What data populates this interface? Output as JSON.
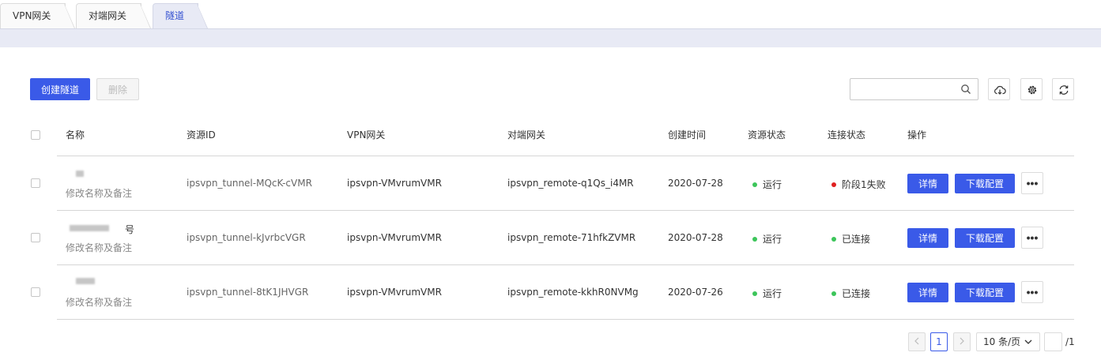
{
  "tabs": [
    {
      "label": "VPN网关"
    },
    {
      "label": "对端网关"
    },
    {
      "label": "隧道"
    }
  ],
  "toolbar": {
    "create_label": "创建隧道",
    "delete_label": "删除",
    "search_value": "",
    "icons": [
      "search-icon",
      "cloud-download-icon",
      "gear-icon",
      "refresh-icon"
    ]
  },
  "table": {
    "columns": [
      "名称",
      "资源ID",
      "VPN网关",
      "对端网关",
      "创建时间",
      "资源状态",
      "连接状态",
      "操作"
    ],
    "rows": [
      {
        "name_visible": "",
        "name_suffix": "",
        "edit_link": "修改名称及备注",
        "resource_id": "ipsvpn_tunnel-MQcK-cVMR",
        "vpn_gateway": "ipsvpn-VMvrumVMR",
        "remote_gateway": "ipsvpn_remote-q1Qs_i4MR",
        "created": "2020-07-28",
        "resource_status": "运行",
        "connection_status": "阶段1失败",
        "connection_color": "#e02020",
        "detail_label": "详情",
        "download_label": "下载配置",
        "more_label": "•••"
      },
      {
        "name_visible": "",
        "name_suffix": "号",
        "edit_link": "修改名称及备注",
        "resource_id": "ipsvpn_tunnel-kJvrbcVGR",
        "vpn_gateway": "ipsvpn-VMvrumVMR",
        "remote_gateway": "ipsvpn_remote-71hfkZVMR",
        "created": "2020-07-28",
        "resource_status": "运行",
        "connection_status": "已连接",
        "connection_color": "#3cc55a",
        "detail_label": "详情",
        "download_label": "下载配置",
        "more_label": "•••"
      },
      {
        "name_visible": "",
        "name_suffix": "",
        "edit_link": "修改名称及备注",
        "resource_id": "ipsvpn_tunnel-8tK1JHVGR",
        "vpn_gateway": "ipsvpn-VMvrumVMR",
        "remote_gateway": "ipsvpn_remote-kkhR0NVMg",
        "created": "2020-07-26",
        "resource_status": "运行",
        "connection_status": "已连接",
        "connection_color": "#3cc55a",
        "detail_label": "详情",
        "download_label": "下载配置",
        "more_label": "•••"
      }
    ],
    "running_color": "#3cc55a"
  },
  "pagination": {
    "current_page": "1",
    "page_size": "10 条/页",
    "jump_value": "",
    "total_pages": "/1"
  },
  "colors": {
    "primary": "#3a5ae8",
    "tab_active_bg": "#e8eaf5",
    "tab_active_text": "#3451d1"
  }
}
